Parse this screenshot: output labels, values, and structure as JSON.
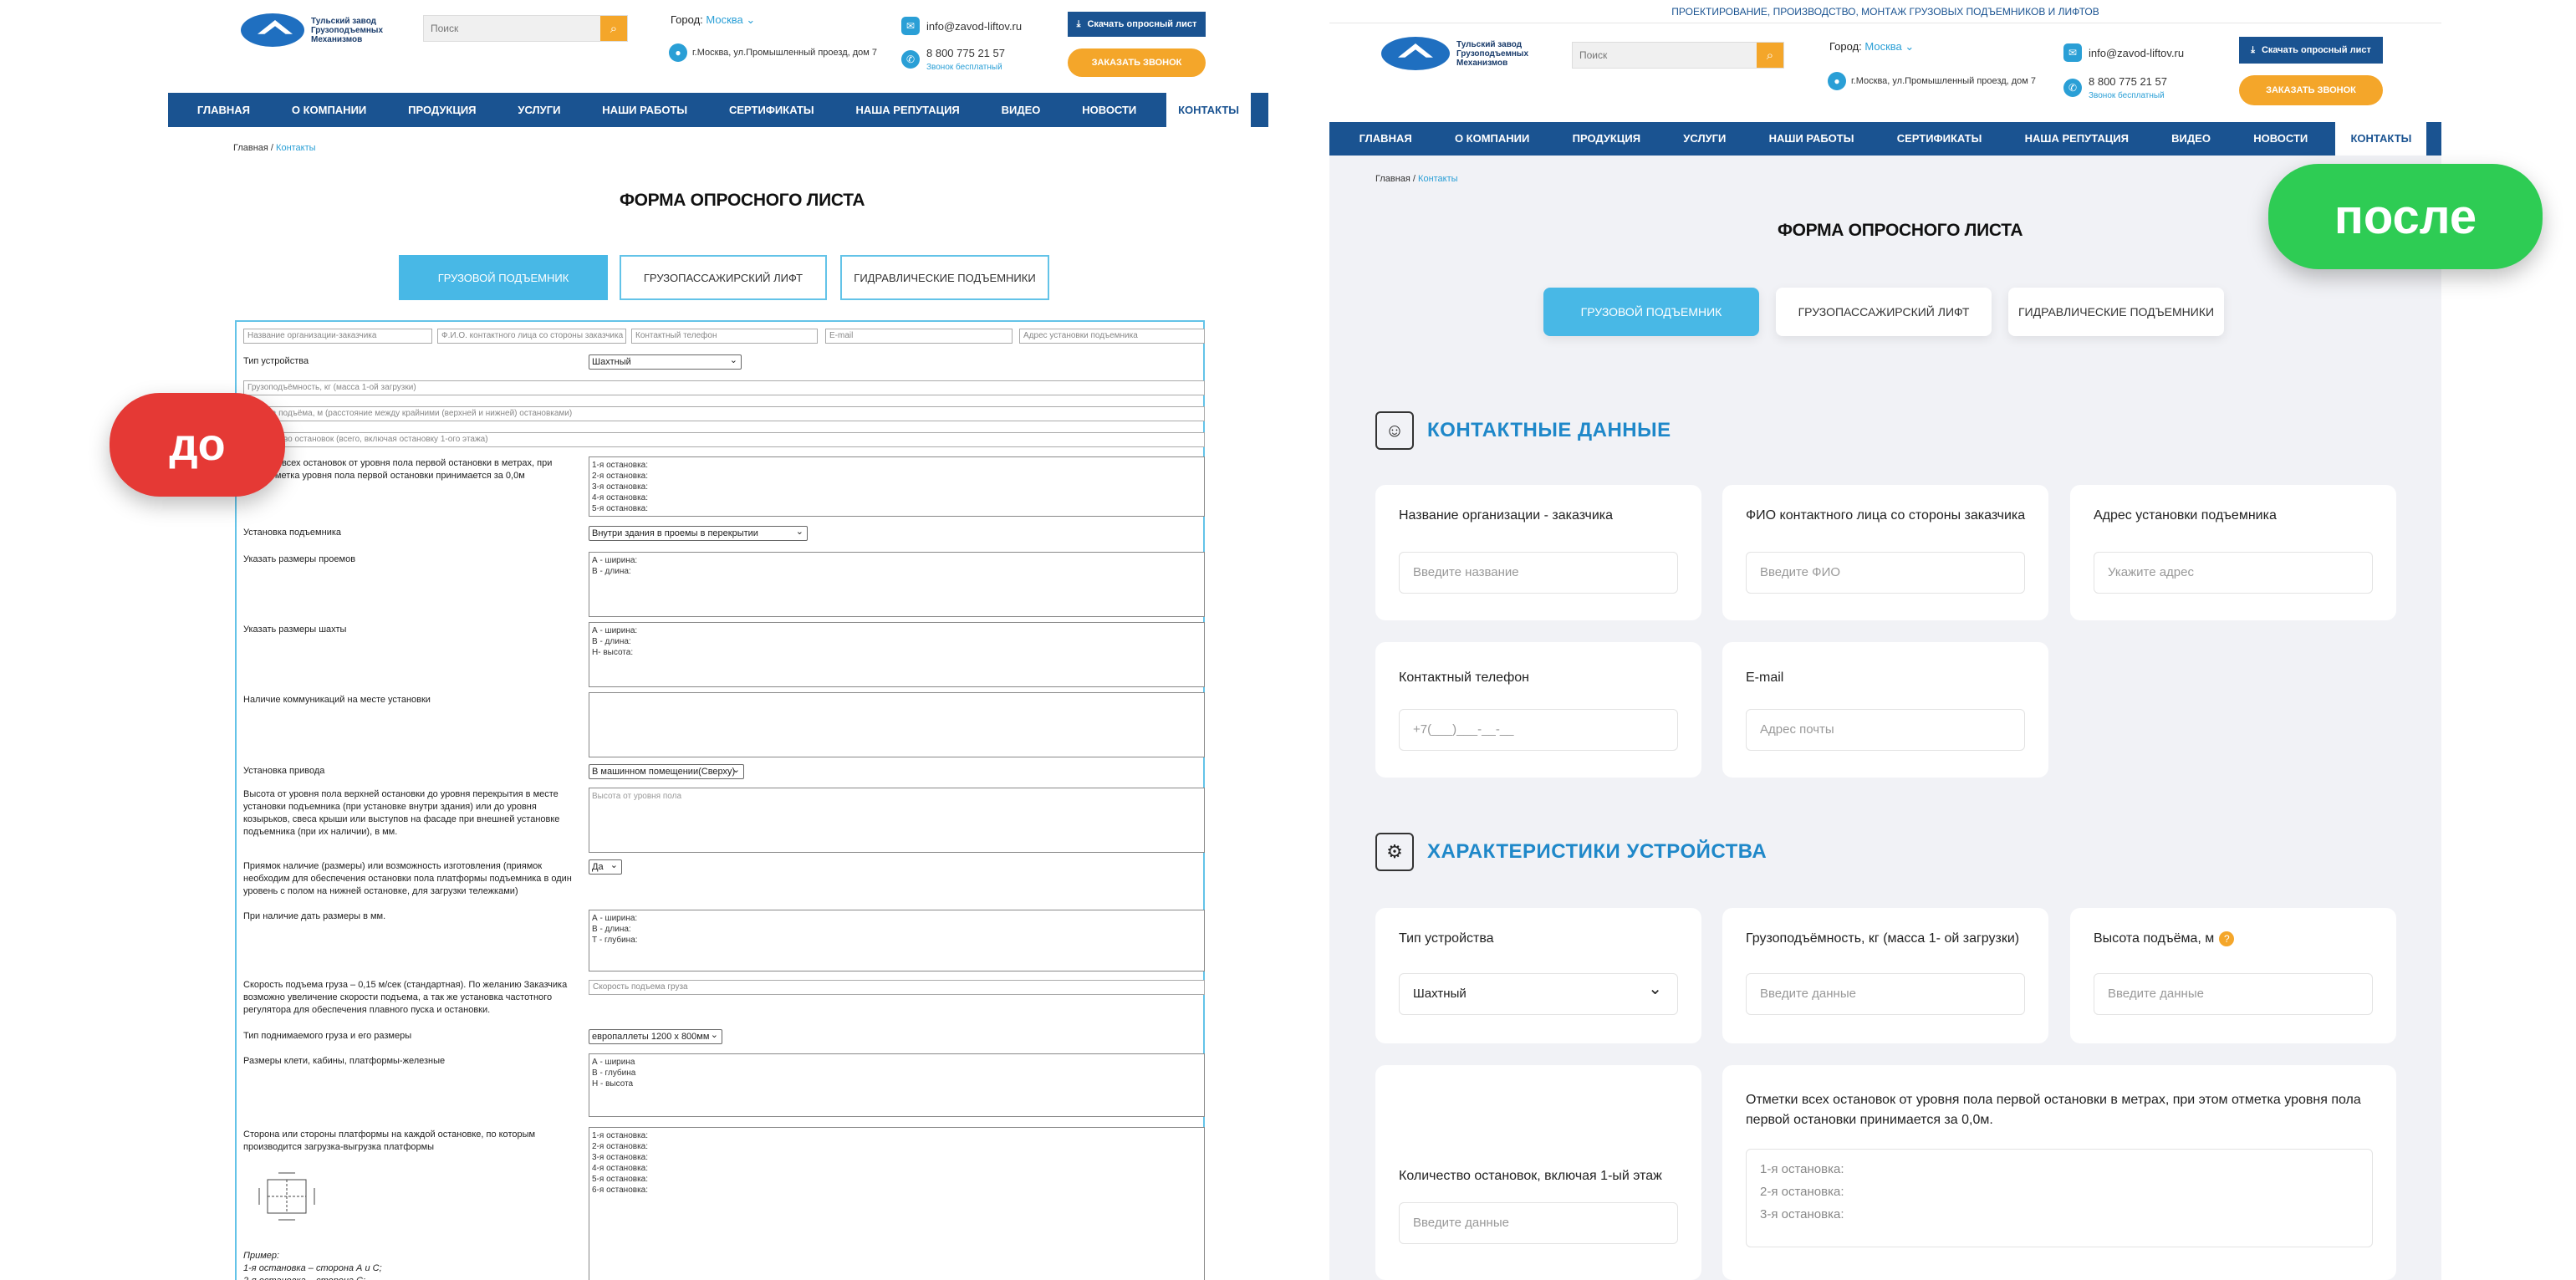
{
  "before": {
    "badge": "до",
    "logo_text": "Тульский завод\nГрузоподъемных\nМеханизмов",
    "search_placeholder": "Поиск",
    "city_label": "Город:",
    "city_value": "Москва",
    "address": "г.Москва, ул.Промышленный проезд, дом 7",
    "email": "info@zavod-liftov.ru",
    "phone": "8 800 775 21 57",
    "phone_note": "Звонок бесплатный",
    "download_btn": "Скачать опросный лист",
    "call_btn": "ЗАКАЗАТЬ ЗВОНОК",
    "nav": [
      "ГЛАВНАЯ",
      "О КОМПАНИИ",
      "ПРОДУКЦИЯ",
      "УСЛУГИ",
      "НАШИ РАБОТЫ",
      "СЕРТИФИКАТЫ",
      "НАША РЕПУТАЦИЯ",
      "ВИДЕО",
      "НОВОСТИ",
      "КОНТАКТЫ"
    ],
    "crumb_home": "Главная",
    "crumb_current": "Контакты",
    "title": "ФОРМА ОПРОСНОГО ЛИСТА",
    "tabs": [
      "ГРУЗОВОЙ ПОДЪЕМНИК",
      "ГРУЗОПАССАЖИРСКИЙ ЛИФТ",
      "ГИДРАВЛИЧЕСКИЕ ПОДЪЕМНИКИ"
    ],
    "top_inputs": [
      "Название организации-заказчика",
      "Ф.И.О. контактного лица со стороны заказчика",
      "Контактный телефон",
      "E-mail",
      "Адрес установки подъемника"
    ],
    "device_type_label": "Тип устройства",
    "device_type_value": "Шахтный",
    "wide_inputs": [
      "Грузоподъёмность, кг (масса 1-ой загрузки)",
      "Высота подъёма, м (расстояние между крайними (верхней и нижней) остановками)",
      "Количество остановок (всего, включая остановку 1-ого этажа)"
    ],
    "stops_label": "Отметки всех остановок от уровня пола первой остановки в метрах, при этом отметка уровня пола первой остановки принимается за 0,0м",
    "stops_value": "1-я остановка:\n2-я остановка:\n3-я остановка:\n4-я остановка:\n5-я остановка:",
    "install_label": "Установка подъемника",
    "install_value": "Внутри здания в проемы в перекрытии",
    "openings_label": "Указать размеры проемов",
    "openings_value": "А - ширина:\nВ - длина:",
    "shaft_label": "Указать размеры шахты",
    "shaft_value": "А - ширина:\nВ - длина:\nН- высота:",
    "comms_label": "Наличие коммуникаций на месте установки",
    "drive_label": "Установка привода",
    "drive_value": "В машинном помещении(Сверху)",
    "height_label": "Высота от уровня пола верхней остановки до уровня перекрытия в месте установки подъемника (при установке внутри здания) или до уровня козырьков, свеса крыши или выступов на фасаде при внешней установке подъемника (при их наличии), в мм.",
    "height_placeholder": "Высота от уровня пола",
    "pit_label": "Приямок наличие (размеры) или возможность изготовления (приямок необходим для обеспечения остановки пола платформы подъемника в один уровень с полом на нижней остановке, для загрузки тележками)",
    "pit_value": "Да",
    "pit_size_label": "При наличие дать размеры в мм.",
    "pit_size_value": "А - ширина:\nВ - длина:\nТ - глубина:",
    "speed_label": "Скорость подъема груза – 0,15 м/сек (стандартная). По желанию Заказчика возможно увеличение скорости подъема, а так же установка частотного регулятора для обеспечения плавного пуска и остановки.",
    "speed_placeholder": "Скорость подъема груза",
    "cargo_label": "Тип поднимаемого груза и его размеры",
    "cargo_value": "европаллеты 1200 х 800мм",
    "cabin_label": "Размеры клети, кабины, платформы-железные",
    "cabin_value": "А - ширина\nВ - глубина\nН - высота",
    "sides_label": "Сторона или стороны платформы на каждой остановке, по которым производится загрузка-выгрузка платформы",
    "sides_value": "1-я остановка:\n2-я остановка:\n3-я остановка:\n4-я остановка:\n5-я остановка:\n6-я остановка:",
    "example": "Пример:\n1-я остановка – сторона А и С;\n2-я остановка – сторона С;"
  },
  "after": {
    "badge": "после",
    "topbar": "ПРОЕКТИРОВАНИЕ, ПРОИЗВОДСТВО, МОНТАЖ ГРУЗОВЫХ ПОДЪЕМНИКОВ И ЛИФТОВ",
    "logo_text": "Тульский завод\nГрузоподъемных\nМеханизмов",
    "search_placeholder": "Поиск",
    "city_label": "Город:",
    "city_value": "Москва",
    "address": "г.Москва, ул.Промышленный проезд, дом 7",
    "email": "info@zavod-liftov.ru",
    "phone": "8 800 775 21 57",
    "phone_note": "Звонок бесплатный",
    "download_btn": "Скачать опросный лист",
    "call_btn": "ЗАКАЗАТЬ ЗВОНОК",
    "nav": [
      "ГЛАВНАЯ",
      "О КОМПАНИИ",
      "ПРОДУКЦИЯ",
      "УСЛУГИ",
      "НАШИ РАБОТЫ",
      "СЕРТИФИКАТЫ",
      "НАША РЕПУТАЦИЯ",
      "ВИДЕО",
      "НОВОСТИ",
      "КОНТАКТЫ"
    ],
    "crumb_home": "Главная",
    "crumb_current": "Контакты",
    "title": "ФОРМА ОПРОСНОГО ЛИСТА",
    "tabs": [
      "ГРУЗОВОЙ ПОДЪЕМНИК",
      "ГРУЗОПАССАЖИРСКИЙ ЛИФТ",
      "ГИДРАВЛИЧЕСКИЕ ПОДЪЕМНИКИ"
    ],
    "contacts_heading": "КОНТАКТНЫЕ ДАННЫЕ",
    "org_label": "Название организации - заказчика",
    "org_placeholder": "Введите название",
    "fio_label": "ФИО контактного лица со стороны заказчика",
    "fio_placeholder": "Введите ФИО",
    "addr_label": "Адрес установки подъемника",
    "addr_placeholder": "Укажите адрес",
    "phone_label": "Контактный телефон",
    "phone_placeholder": "+7(___)___-__-__",
    "email_label": "E-mail",
    "email_placeholder": "Адрес почты",
    "chars_heading": "ХАРАКТЕРИСТИКИ УСТРОЙСТВА",
    "type_label": "Тип устройства",
    "type_value": "Шахтный",
    "load_label": "Грузоподъёмность, кг (масса 1- ой загрузки)",
    "load_placeholder": "Введите данные",
    "lift_height_label": "Высота подъёма, м",
    "lift_height_placeholder": "Введите данные",
    "stops_count_label": "Количество остановок, включая 1-ый этаж",
    "stops_count_placeholder": "Введите данные",
    "stops_marks_label": "Отметки всех остановок от уровня пола первой остановки в метрах, при этом отметка уровня пола первой остановки принимается за 0,0м.",
    "stops_marks_value": "1-я остановка:\n2-я остановка:\n3-я остановка:"
  },
  "colors": {
    "nav": "#1a5391",
    "accent": "#48b8e6",
    "orange": "#f4a62a",
    "badge_before": "#e53935",
    "badge_after": "#2ecc54"
  }
}
